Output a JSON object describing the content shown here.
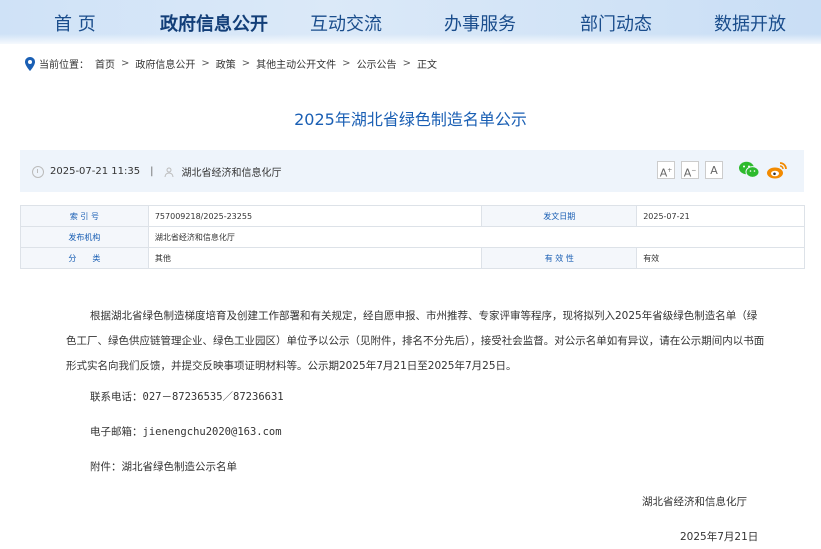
{
  "nav": {
    "items": [
      "首 页",
      "政府信息公开",
      "互动交流",
      "办事服务",
      "部门动态",
      "数据开放"
    ],
    "active_index": 1
  },
  "breadcrumb": {
    "label": "当前位置：",
    "items": [
      "首页",
      "政府信息公开",
      "政策",
      "其他主动公开文件",
      "公示公告",
      "正文"
    ],
    "separator": ">"
  },
  "article": {
    "title": "2025年湖北省绿色制造名单公示",
    "datetime": "2025-07-21 11:35",
    "meta_sep": "|",
    "publisher": "湖北省经济和信息化厅",
    "font_controls": [
      "A",
      "A",
      "A"
    ],
    "body": "根据湖北省绿色制造梯度培育及创建工作部署和有关规定，经自愿申报、市州推荐、专家评审等程序，现将拟列入2025年省级绿色制造名单（绿色工厂、绿色供应链管理企业、绿色工业园区）单位予以公示（见附件，排名不分先后），接受社会监督。对公示名单如有异议，请在公示期间内以书面形式实名向我们反馈，并提交反映事项证明材料等。公示期2025年7月21日至2025年7月25日。",
    "contact": "联系电话：027－87236535／87236631",
    "email": "电子邮箱：jienengchu2020@163.com",
    "attachment": "附件：湖北省绿色制造公示名单",
    "signature": "湖北省经济和信息化厅",
    "date": "2025年7月21日"
  },
  "info_table": {
    "rows": [
      {
        "k1": "索 引 号",
        "v1": "757009218/2025-23255",
        "k2": "发文日期",
        "v2": "2025-07-21"
      },
      {
        "k1": "发布机构",
        "v1": "湖北省经济和信息化厅",
        "k2": "",
        "v2": ""
      },
      {
        "k1": "分　　类",
        "v1": "其他",
        "k2": "有 效 性",
        "v2": "有效"
      }
    ]
  },
  "colors": {
    "accent": "#1a5fb4",
    "nav_text": "#1a4d8c",
    "meta_bg": "#eef4fb",
    "wechat": "#2dba2d",
    "weibo": "#f28a00"
  },
  "icons": [
    "location-pin-icon",
    "clock-icon",
    "person-icon",
    "wechat-icon",
    "weibo-icon"
  ]
}
